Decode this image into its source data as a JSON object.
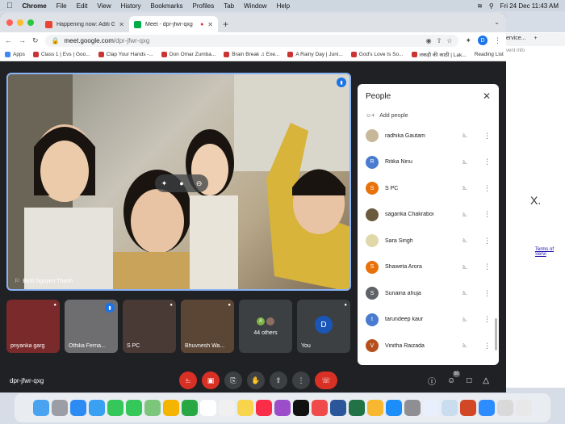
{
  "menubar": {
    "app": "Chrome",
    "items": [
      "File",
      "Edit",
      "View",
      "History",
      "Bookmarks",
      "Profiles",
      "Tab",
      "Window",
      "Help"
    ],
    "clock": "Fri 24 Dec  11:43 AM"
  },
  "tabs": [
    {
      "title": "Happening now: Aditi Gupta is",
      "color": "#ea4335"
    },
    {
      "title": "Meet - dpr-jfwr-qxg",
      "color": "#00ac47"
    }
  ],
  "url": {
    "host": "meet.google.com",
    "path": "/dpr-jfwr-qxg"
  },
  "profile_initial": "D",
  "bookmarks": [
    "Apps",
    "Class 1 | Evs | Goo...",
    "Clap Your Hands -...",
    "Don Omar Zumba...",
    "Brain Break ♫ Exe...",
    "A Rainy Day | Juni...",
    "God's Love Is So...",
    "लकड़ी की काठी | Lak..."
  ],
  "reading_list": "Reading List",
  "back_window": {
    "tab": "ervice...",
    "event_info": "Event Info",
    "terms": "Terms of Servi",
    "bigx": "X."
  },
  "main_speaker": {
    "name": "Binh Nguyen Thanh"
  },
  "tiles": [
    {
      "name": "priyanka garg",
      "color": "#7a2a2a"
    },
    {
      "name": "Othilia Ferna...",
      "color": "#6e6e70"
    },
    {
      "name": "S PC",
      "color": "#4a3a36"
    },
    {
      "name": "Bhuvnesh Wa...",
      "color": "#5b4636"
    }
  ],
  "others": {
    "label": "44 others",
    "avatars": [
      "A",
      ""
    ]
  },
  "you": {
    "label": "You",
    "initial": "D"
  },
  "panel": {
    "title": "People",
    "add_label": "Add people",
    "people": [
      {
        "name": "radhika Gautam",
        "initial": "",
        "color": "#c8b89a"
      },
      {
        "name": "Ritika Ninu",
        "initial": "R",
        "color": "#4a7bd0"
      },
      {
        "name": "S PC",
        "initial": "S",
        "color": "#e8710a"
      },
      {
        "name": "sagarika Chakraborty",
        "initial": "",
        "color": "#6b5a3e"
      },
      {
        "name": "Sara Singh",
        "initial": "",
        "color": "#e0d8a8"
      },
      {
        "name": "Shaweta Arora",
        "initial": "S",
        "color": "#e8710a"
      },
      {
        "name": "Sunaina ahuja",
        "initial": "S",
        "color": "#5f6368"
      },
      {
        "name": "tarundeep kaur",
        "initial": "t",
        "color": "#4a7bd0"
      },
      {
        "name": "Vinitha Raizada",
        "initial": "V",
        "color": "#b5501d"
      }
    ]
  },
  "meeting_code": "dpr-jfwr-qxg",
  "participant_count": "50"
}
